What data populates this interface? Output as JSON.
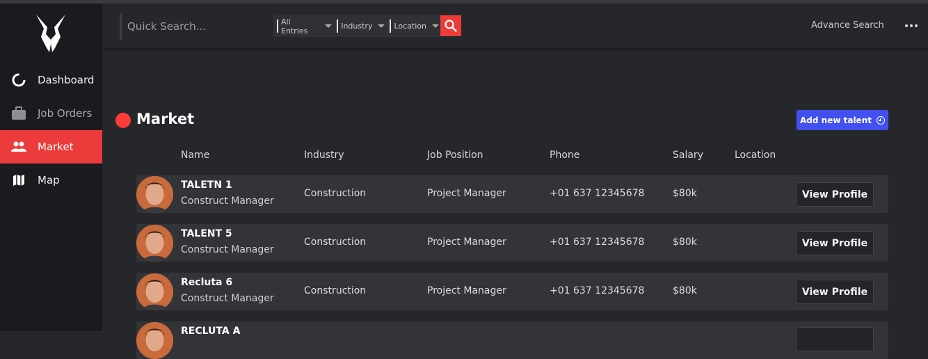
{
  "sidebar": {
    "logo": "wolf-logo",
    "items": [
      {
        "label": "Dashboard",
        "icon": "donut-chart-icon"
      },
      {
        "label": "Job Orders",
        "icon": "briefcase-icon"
      },
      {
        "label": "Market",
        "icon": "people-icon",
        "active": true
      },
      {
        "label": "Map",
        "icon": "map-icon"
      }
    ]
  },
  "topbar": {
    "search_placeholder": "Quick Search...",
    "filters": [
      "All Entries",
      "Industry",
      "Location"
    ],
    "advance_search": "Advance Search"
  },
  "main": {
    "title": "Market",
    "add_button": "Add new talent",
    "columns": [
      "Name",
      "Industry",
      "Job Position",
      "Phone",
      "Salary",
      "Location"
    ],
    "rows": [
      {
        "name": "TALETN 1",
        "subtitle": "Construct Manager",
        "industry": "Construction",
        "position": "Project Manager",
        "phone": "+01 637 12345678",
        "salary": "$80k",
        "location": "",
        "action": "View Profile"
      },
      {
        "name": "TALENT 5",
        "subtitle": "Construct Manager",
        "industry": "Construction",
        "position": "Project Manager",
        "phone": "+01 637 12345678",
        "salary": "$80k",
        "location": "",
        "action": "View Profile"
      },
      {
        "name": "Recluta 6",
        "subtitle": "Construct Manager",
        "industry": "Construction",
        "position": "Project Manager",
        "phone": "+01 637 12345678",
        "salary": "$80k",
        "location": "",
        "action": "View Profile"
      },
      {
        "name": "RECLUTA A",
        "subtitle": "",
        "industry": "",
        "position": "",
        "phone": "",
        "salary": "",
        "location": "",
        "action": ""
      }
    ]
  },
  "colors": {
    "accent_red": "#ec3b3b",
    "primary_blue": "#4350f0",
    "sidebar_bg": "#1a1b1e",
    "page_bg": "#25272b",
    "row_bg": "#323438"
  }
}
